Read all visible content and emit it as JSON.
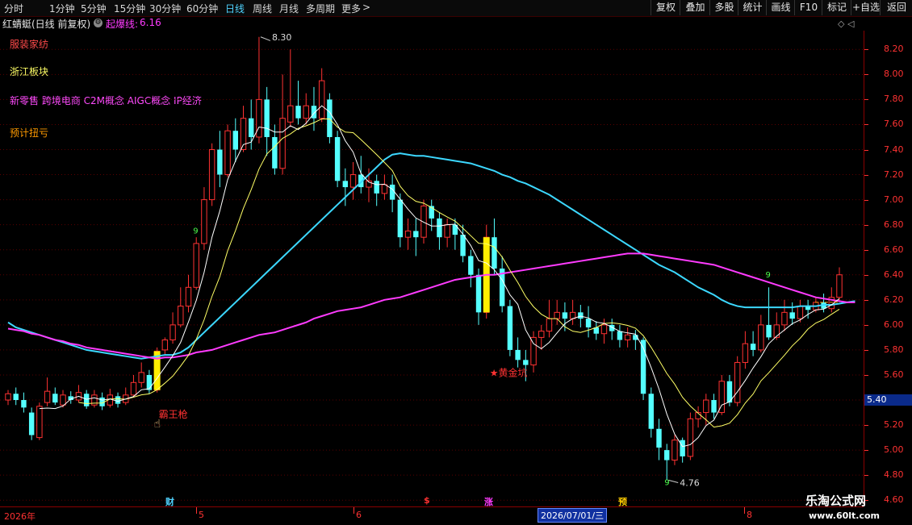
{
  "toolbar": {
    "tabs": [
      {
        "label": "分时",
        "active": false
      },
      {
        "label": "1分钟",
        "active": false
      },
      {
        "label": "5分钟",
        "active": false
      },
      {
        "label": "15分钟",
        "active": false
      },
      {
        "label": "30分钟",
        "active": false
      },
      {
        "label": "60分钟",
        "active": false
      },
      {
        "label": "日线",
        "active": true
      },
      {
        "label": "周线",
        "active": false
      },
      {
        "label": "月线",
        "active": false
      },
      {
        "label": "多周期",
        "active": false
      },
      {
        "label": "更多",
        "active": false
      }
    ],
    "more_arrow": ">",
    "buttons": [
      "复权",
      "叠加",
      "多股",
      "统计",
      "画线",
      "F10",
      "标记",
      "+自选",
      "返回"
    ]
  },
  "header": {
    "title": "红蜻蜓(日线 前复权)",
    "indicator_icon": "⚙",
    "indicator_name": "起爆线:",
    "indicator_value": "6.16"
  },
  "concepts": [
    {
      "text": "服装家纺",
      "color": "#ff4a4a"
    },
    {
      "text": "浙江板块",
      "color": "#ffff66"
    },
    {
      "text": "新零售 跨境电商 C2M概念 AIGC概念 IP经济",
      "color": "#ff4bff"
    },
    {
      "text": "预计扭亏",
      "color": "#ff9a00"
    }
  ],
  "colors": {
    "up": "#ff3232",
    "down": "#54ffff",
    "ma5": "#ffffff",
    "ma10": "#ffff66",
    "ma20": "#ff3bff",
    "ma60": "#3cd8ff",
    "axis": "#ff3232",
    "grid": "#5a0000"
  },
  "axis": {
    "labels": [
      "8.20",
      "8.00",
      "7.80",
      "7.60",
      "7.40",
      "7.20",
      "7.00",
      "6.80",
      "6.60",
      "6.40",
      "6.20",
      "6.00",
      "5.80",
      "5.60",
      "5.40",
      "5.20",
      "5.00",
      "4.80",
      "4.60"
    ],
    "current_price": "5.40"
  },
  "annotations": {
    "high_label": "8.30",
    "low_label": "4.76",
    "signal_1": "霸王枪",
    "signal_2": "★黄金坑",
    "nine_1": "9",
    "nine_2": "9",
    "nine_3": "9"
  },
  "date_bar": {
    "year": "2026年",
    "months": [
      "5",
      "6",
      "8"
    ],
    "cursor_date": "2026/07/01/三",
    "markers": [
      {
        "text": "财",
        "color": "#4fd3ff"
      },
      {
        "text": "$",
        "color": "#ff3232"
      },
      {
        "text": "涨",
        "color": "#ff3bff"
      },
      {
        "text": "预",
        "color": "#ffcc00"
      }
    ]
  },
  "watermark": {
    "line1": "乐淘公式网",
    "line2": "www.60lt.com"
  },
  "chart_data": {
    "type": "candlestick",
    "ylim": [
      4.55,
      8.35
    ],
    "candles": [
      [
        5.4,
        5.45,
        5.48,
        5.36
      ],
      [
        5.45,
        5.4,
        5.5,
        5.36
      ],
      [
        5.4,
        5.34,
        5.46,
        5.3
      ],
      [
        5.3,
        5.12,
        5.34,
        5.08
      ],
      [
        5.1,
        5.35,
        5.38,
        5.08
      ],
      [
        5.38,
        5.47,
        5.58,
        5.35
      ],
      [
        5.45,
        5.38,
        5.5,
        5.36
      ],
      [
        5.36,
        5.44,
        5.48,
        5.34
      ],
      [
        5.43,
        5.4,
        5.47,
        5.37
      ],
      [
        5.4,
        5.46,
        5.52,
        5.38
      ],
      [
        5.45,
        5.35,
        5.48,
        5.33
      ],
      [
        5.36,
        5.44,
        5.48,
        5.34
      ],
      [
        5.42,
        5.35,
        5.46,
        5.32
      ],
      [
        5.36,
        5.44,
        5.49,
        5.34
      ],
      [
        5.43,
        5.37,
        5.46,
        5.34
      ],
      [
        5.38,
        5.44,
        5.5,
        5.36
      ],
      [
        5.44,
        5.54,
        5.6,
        5.42
      ],
      [
        5.54,
        5.62,
        5.7,
        5.5
      ],
      [
        5.6,
        5.48,
        5.64,
        5.45
      ],
      [
        5.48,
        5.79,
        5.82,
        5.46
      ],
      [
        5.8,
        5.88,
        5.9,
        5.76
      ],
      [
        5.88,
        6.0,
        6.1,
        5.85
      ],
      [
        6.0,
        6.15,
        6.3,
        5.98
      ],
      [
        6.15,
        6.3,
        6.4,
        6.1
      ],
      [
        6.3,
        6.65,
        6.7,
        6.28
      ],
      [
        6.65,
        7.0,
        7.1,
        6.6
      ],
      [
        7.0,
        7.4,
        7.45,
        6.95
      ],
      [
        7.4,
        7.2,
        7.55,
        7.1
      ],
      [
        7.2,
        7.55,
        7.6,
        7.18
      ],
      [
        7.55,
        7.4,
        7.65,
        7.3
      ],
      [
        7.4,
        7.65,
        7.75,
        7.38
      ],
      [
        7.65,
        7.5,
        7.8,
        7.4
      ],
      [
        7.5,
        7.8,
        8.3,
        7.45
      ],
      [
        7.8,
        7.5,
        7.9,
        7.35
      ],
      [
        7.5,
        7.25,
        7.6,
        7.2
      ],
      [
        7.25,
        7.65,
        8.0,
        7.2
      ],
      [
        7.62,
        7.75,
        8.2,
        7.58
      ],
      [
        7.75,
        7.65,
        7.95,
        7.6
      ],
      [
        7.65,
        7.75,
        7.85,
        7.6
      ],
      [
        7.75,
        7.65,
        7.9,
        7.55
      ],
      [
        7.65,
        7.95,
        8.05,
        7.62
      ],
      [
        7.8,
        7.5,
        7.85,
        7.45
      ],
      [
        7.5,
        7.15,
        7.55,
        7.1
      ],
      [
        7.15,
        7.1,
        7.25,
        6.95
      ],
      [
        7.1,
        7.2,
        7.3,
        7.0
      ],
      [
        7.2,
        7.1,
        7.35,
        7.05
      ],
      [
        7.1,
        7.15,
        7.25,
        6.98
      ],
      [
        7.15,
        7.05,
        7.2,
        6.95
      ],
      [
        7.05,
        7.12,
        7.2,
        7.0
      ],
      [
        7.12,
        7.0,
        7.2,
        6.9
      ],
      [
        7.0,
        6.7,
        7.05,
        6.62
      ],
      [
        6.7,
        6.75,
        6.85,
        6.6
      ],
      [
        6.75,
        6.7,
        6.85,
        6.55
      ],
      [
        6.7,
        6.95,
        7.0,
        6.65
      ],
      [
        6.95,
        6.85,
        7.0,
        6.75
      ],
      [
        6.85,
        6.7,
        6.9,
        6.6
      ],
      [
        6.7,
        6.8,
        6.85,
        6.62
      ],
      [
        6.8,
        6.72,
        6.85,
        6.6
      ],
      [
        6.72,
        6.55,
        6.8,
        6.5
      ],
      [
        6.55,
        6.4,
        6.6,
        6.3
      ],
      [
        6.4,
        6.1,
        6.45,
        6.0
      ],
      [
        6.1,
        6.7,
        6.8,
        6.05
      ],
      [
        6.7,
        6.45,
        6.85,
        6.4
      ],
      [
        6.45,
        6.15,
        6.55,
        6.1
      ],
      [
        6.15,
        5.8,
        6.2,
        5.75
      ],
      [
        5.8,
        5.72,
        5.9,
        5.66
      ],
      [
        5.72,
        5.68,
        5.8,
        5.55
      ],
      [
        5.68,
        5.9,
        5.95,
        5.62
      ],
      [
        5.9,
        5.95,
        6.0,
        5.8
      ],
      [
        5.95,
        6.05,
        6.2,
        5.9
      ],
      [
        6.05,
        6.1,
        6.2,
        6.0
      ],
      [
        6.1,
        6.05,
        6.18,
        5.95
      ],
      [
        6.05,
        6.1,
        6.2,
        6.0
      ],
      [
        6.1,
        6.05,
        6.16,
        5.98
      ],
      [
        6.05,
        5.98,
        6.15,
        5.9
      ],
      [
        5.98,
        5.93,
        6.03,
        5.88
      ],
      [
        5.93,
        6.0,
        6.05,
        5.85
      ],
      [
        6.0,
        5.95,
        6.05,
        5.88
      ],
      [
        5.95,
        5.88,
        6.0,
        5.82
      ],
      [
        5.88,
        5.92,
        5.98,
        5.82
      ],
      [
        5.92,
        5.88,
        5.96,
        5.8
      ],
      [
        5.88,
        5.45,
        5.9,
        5.4
      ],
      [
        5.45,
        5.17,
        5.5,
        5.1
      ],
      [
        5.17,
        5.02,
        5.25,
        4.92
      ],
      [
        5.0,
        4.92,
        5.05,
        4.76
      ],
      [
        4.92,
        5.08,
        5.12,
        4.88
      ],
      [
        5.08,
        4.95,
        5.1,
        4.9
      ],
      [
        4.95,
        5.25,
        5.3,
        4.92
      ],
      [
        5.25,
        5.3,
        5.35,
        5.18
      ],
      [
        5.3,
        5.4,
        5.45,
        5.2
      ],
      [
        5.4,
        5.3,
        5.45,
        5.25
      ],
      [
        5.3,
        5.55,
        5.6,
        5.28
      ],
      [
        5.55,
        5.38,
        5.6,
        5.35
      ],
      [
        5.38,
        5.7,
        5.75,
        5.35
      ],
      [
        5.7,
        5.85,
        5.95,
        5.65
      ],
      [
        5.85,
        5.8,
        5.95,
        5.75
      ],
      [
        5.8,
        6.0,
        6.08,
        5.78
      ],
      [
        6.0,
        5.9,
        6.3,
        5.88
      ],
      [
        5.9,
        6.0,
        6.1,
        5.88
      ],
      [
        6.0,
        6.1,
        6.2,
        5.95
      ],
      [
        6.1,
        6.05,
        6.18,
        6.0
      ],
      [
        6.05,
        6.15,
        6.2,
        6.02
      ],
      [
        6.15,
        6.12,
        6.2,
        6.05
      ],
      [
        6.12,
        6.18,
        6.22,
        6.1
      ],
      [
        6.18,
        6.13,
        6.25,
        6.1
      ],
      [
        6.13,
        6.22,
        6.3,
        6.1
      ],
      [
        6.22,
        6.4,
        6.46,
        6.18
      ]
    ],
    "ma60": [
      6.02,
      5.98,
      5.96,
      5.94,
      5.92,
      5.9,
      5.88,
      5.86,
      5.84,
      5.82,
      5.8,
      5.79,
      5.78,
      5.77,
      5.76,
      5.75,
      5.74,
      5.73,
      5.74,
      5.75,
      5.76,
      5.76,
      5.78,
      5.82,
      5.88,
      5.94,
      6.0,
      6.06,
      6.12,
      6.18,
      6.24,
      6.3,
      6.36,
      6.42,
      6.48,
      6.54,
      6.6,
      6.66,
      6.72,
      6.78,
      6.84,
      6.9,
      6.96,
      7.02,
      7.08,
      7.14,
      7.2,
      7.26,
      7.32,
      7.36,
      7.37,
      7.36,
      7.35,
      7.35,
      7.34,
      7.33,
      7.32,
      7.31,
      7.3,
      7.29,
      7.27,
      7.25,
      7.23,
      7.2,
      7.18,
      7.15,
      7.13,
      7.1,
      7.07,
      7.04,
      7.0,
      6.96,
      6.92,
      6.88,
      6.84,
      6.8,
      6.76,
      6.72,
      6.68,
      6.64,
      6.6,
      6.56,
      6.52,
      6.48,
      6.45,
      6.42,
      6.38,
      6.34,
      6.3,
      6.27,
      6.24,
      6.2,
      6.17,
      6.15,
      6.14,
      6.14,
      6.14,
      6.14,
      6.14,
      6.14,
      6.14,
      6.15,
      6.15,
      6.15,
      6.16,
      6.16,
      6.17,
      6.18,
      6.19
    ],
    "ma20": [
      5.97,
      5.96,
      5.95,
      5.93,
      5.92,
      5.9,
      5.88,
      5.87,
      5.85,
      5.84,
      5.82,
      5.81,
      5.8,
      5.79,
      5.78,
      5.77,
      5.76,
      5.75,
      5.74,
      5.73,
      5.74,
      5.74,
      5.75,
      5.76,
      5.78,
      5.79,
      5.8,
      5.82,
      5.84,
      5.86,
      5.88,
      5.9,
      5.92,
      5.93,
      5.94,
      5.96,
      5.98,
      6.0,
      6.02,
      6.05,
      6.07,
      6.09,
      6.11,
      6.12,
      6.13,
      6.14,
      6.16,
      6.18,
      6.2,
      6.21,
      6.22,
      6.24,
      6.26,
      6.28,
      6.3,
      6.32,
      6.34,
      6.36,
      6.37,
      6.38,
      6.39,
      6.4,
      6.4,
      6.41,
      6.42,
      6.43,
      6.44,
      6.45,
      6.46,
      6.47,
      6.48,
      6.49,
      6.5,
      6.51,
      6.52,
      6.53,
      6.54,
      6.55,
      6.56,
      6.57,
      6.57,
      6.57,
      6.56,
      6.55,
      6.54,
      6.53,
      6.52,
      6.51,
      6.5,
      6.49,
      6.48,
      6.46,
      6.44,
      6.42,
      6.4,
      6.38,
      6.36,
      6.34,
      6.32,
      6.3,
      6.28,
      6.26,
      6.24,
      6.22,
      6.21,
      6.2,
      6.19,
      6.18,
      6.18
    ]
  }
}
